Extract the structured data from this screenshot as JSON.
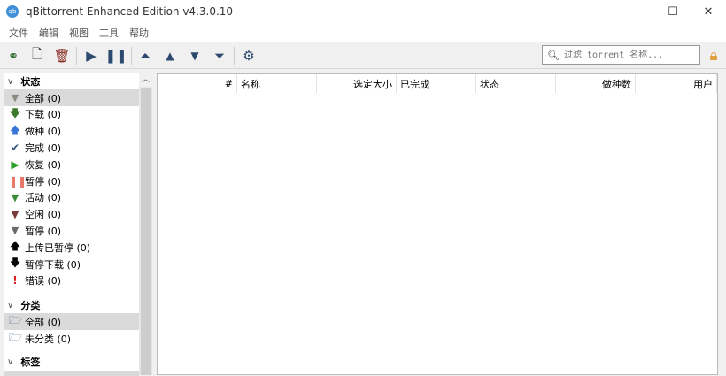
{
  "window": {
    "title": "qBittorrent Enhanced Edition v4.3.0.10",
    "logo": "qb",
    "minimize": "—",
    "maximize": "☐",
    "close": "✕"
  },
  "menu": [
    "文件",
    "编辑",
    "视图",
    "工具",
    "帮助"
  ],
  "search": {
    "placeholder": "过滤 torrent 名称..."
  },
  "sidebar": {
    "status_header": "状态",
    "status_items": [
      {
        "label": "全部 (0)",
        "icon": "filter-icon",
        "color": "#8a8a80"
      },
      {
        "label": "下载 (0)",
        "icon": "arrow-down-icon",
        "color": "#3a7a2a"
      },
      {
        "label": "做种 (0)",
        "icon": "arrow-up-icon",
        "color": "#3a76d9"
      },
      {
        "label": "完成 (0)",
        "icon": "check-icon",
        "color": "#34537a"
      },
      {
        "label": "恢复 (0)",
        "icon": "play-icon",
        "color": "#2aa02a"
      },
      {
        "label": "暂停 (0)",
        "icon": "pause-icon",
        "color": "#e8776a"
      },
      {
        "label": "活动 (0)",
        "icon": "filter-icon",
        "color": "#3a8a3a"
      },
      {
        "label": "空闲 (0)",
        "icon": "filter-icon",
        "color": "#7a3a3a"
      },
      {
        "label": "暂停 (0)",
        "icon": "filter-icon",
        "color": "#6a6a6a"
      },
      {
        "label": "上传已暂停 (0)",
        "icon": "arrow-up-icon",
        "color": "#000000"
      },
      {
        "label": "暂停下载 (0)",
        "icon": "arrow-down-icon",
        "color": "#000000"
      },
      {
        "label": "错误 (0)",
        "icon": "exclamation-icon",
        "color": "#e02020"
      }
    ],
    "category_header": "分类",
    "category_items": [
      "全部 (0)",
      "未分类 (0)"
    ],
    "tags_header": "标签"
  },
  "table": {
    "columns": [
      "#",
      "名称",
      "选定大小",
      "已完成",
      "状态",
      "做种数",
      "用户"
    ]
  }
}
